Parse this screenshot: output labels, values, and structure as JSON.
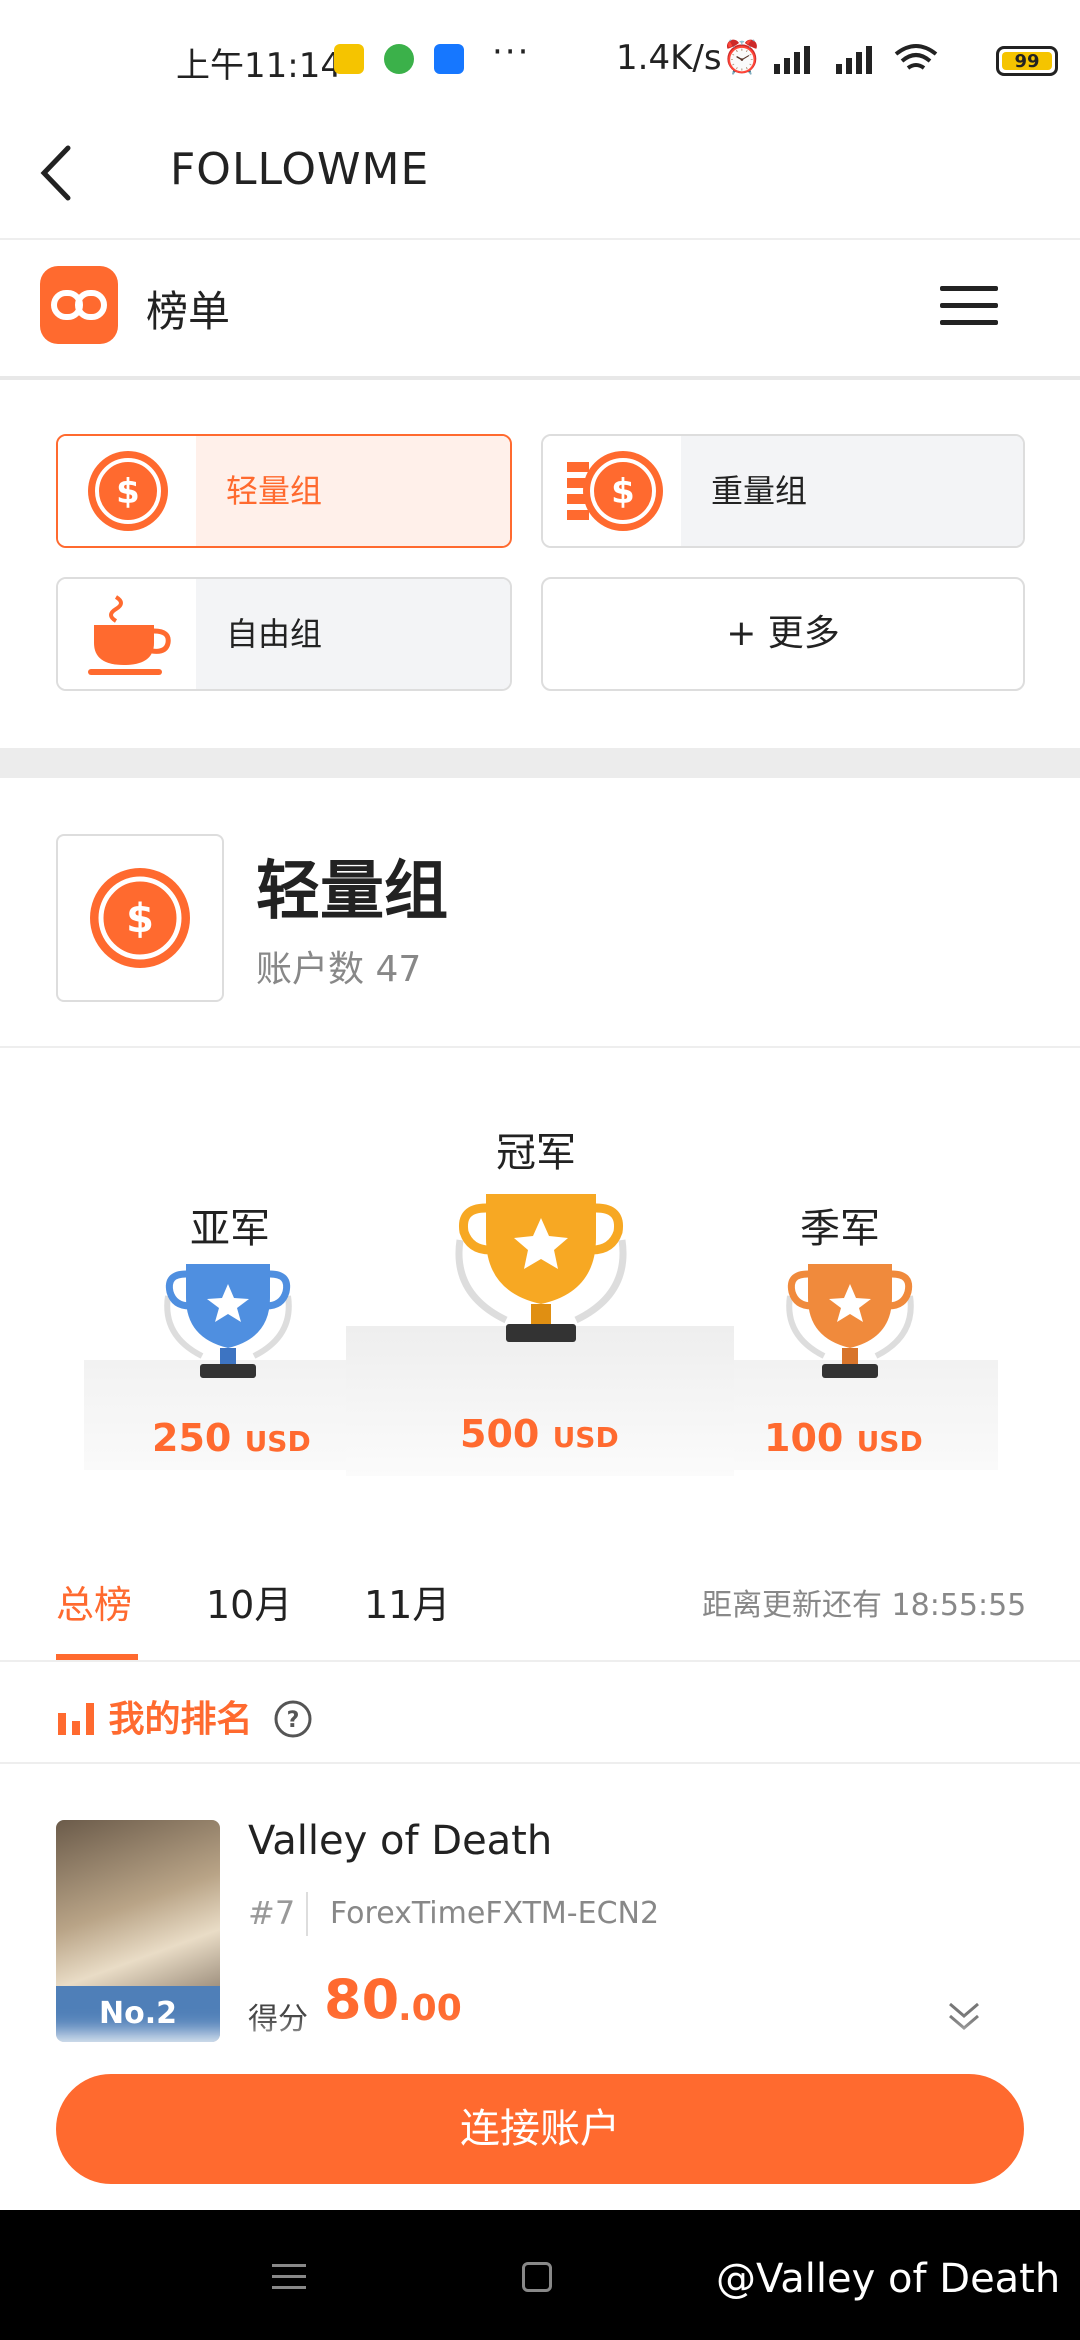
{
  "status_bar": {
    "time": "上午11:14",
    "dots": "···",
    "speed": "1.4K/s",
    "battery": "99"
  },
  "header": {
    "title": "FOLLOWME"
  },
  "subheader": {
    "title": "榜单"
  },
  "categories": [
    {
      "label": "轻量组"
    },
    {
      "label": "重量组"
    },
    {
      "label": "自由组"
    },
    {
      "label": "+ 更多"
    }
  ],
  "group": {
    "name": "轻量组",
    "count_label": "账户数 47"
  },
  "podium": {
    "second": {
      "label": "亚军",
      "amount": "250",
      "unit": "USD"
    },
    "first": {
      "label": "冠军",
      "amount": "500",
      "unit": "USD"
    },
    "third": {
      "label": "季军",
      "amount": "100",
      "unit": "USD"
    }
  },
  "tabs": [
    {
      "label": "总榜"
    },
    {
      "label": "10月"
    },
    {
      "label": "11月"
    }
  ],
  "update_text": "距离更新还有 18:55:55",
  "my_rank_label": "我的排名",
  "entry": {
    "badge": "No.2",
    "name": "Valley of Death",
    "rank": "#7",
    "server": "ForexTimeFXTM-ECN2",
    "score_label": "得分",
    "score_int": "80",
    "score_dec": ".00"
  },
  "cta_label": "连接账户",
  "watermark": "@Valley of Death",
  "colors": {
    "accent": "#ff6a2f",
    "gold": "#f7a823",
    "silver": "#4f8fe0",
    "bronze": "#f08a3c"
  }
}
